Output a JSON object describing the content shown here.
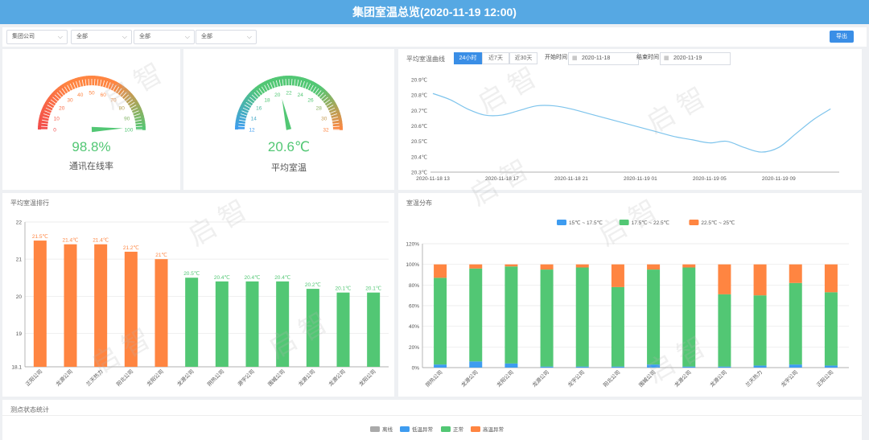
{
  "header": {
    "title": "集团室温总览(2020-11-19 12:00)"
  },
  "toolbar": {
    "filters": [
      "集团公司",
      "全部",
      "全部",
      "全部"
    ],
    "export_label": "导出"
  },
  "gauge_online": {
    "value_text": "98.8%",
    "value": 98.8,
    "label": "通讯在线率",
    "ticks": [
      "0",
      "10",
      "20",
      "30",
      "40",
      "50",
      "60",
      "70",
      "80",
      "90",
      "100"
    ],
    "min": 0,
    "max": 100
  },
  "gauge_temp": {
    "value_text": "20.6℃",
    "value": 20.6,
    "label": "平均室温",
    "ticks": [
      "12",
      "14",
      "16",
      "18",
      "20",
      "22",
      "24",
      "26",
      "28",
      "30",
      "32"
    ],
    "min": 12,
    "max": 32
  },
  "trend": {
    "title": "平均室温曲线",
    "tabs": [
      "24小时",
      "近7天",
      "近30天"
    ],
    "start_label": "开始时间",
    "start_value": "2020-11-18",
    "end_label": "结束时间",
    "end_value": "2020-11-19",
    "chart_data": {
      "type": "line",
      "y_ticks": [
        "20.3℃",
        "20.4℃",
        "20.5℃",
        "20.6℃",
        "20.7℃",
        "20.8℃",
        "20.9℃"
      ],
      "x_ticks": [
        "2020-11-18 13",
        "2020-11-18 17",
        "2020-11-18 21",
        "2020-11-19 01",
        "2020-11-19 05",
        "2020-11-19 09"
      ],
      "ylim": [
        20.3,
        20.9
      ],
      "x": [
        0,
        1,
        2,
        3,
        4,
        5,
        6,
        7,
        8,
        9,
        10,
        11,
        12,
        13,
        14,
        15,
        16,
        17,
        18,
        19,
        20,
        21,
        22,
        23
      ],
      "values": [
        20.81,
        20.77,
        20.71,
        20.67,
        20.67,
        20.7,
        20.73,
        20.73,
        20.71,
        20.68,
        20.65,
        20.62,
        20.59,
        20.56,
        20.53,
        20.51,
        20.49,
        20.5,
        20.46,
        20.43,
        20.46,
        20.55,
        20.64,
        20.71
      ],
      "color": "#7ec4ec"
    }
  },
  "ranking": {
    "title": "平均室温排行",
    "chart_data": {
      "type": "bar",
      "categories": [
        "正阳公司",
        "龙源公司",
        "兰天热力",
        "阳北公司",
        "龙阳公司",
        "龙源公司",
        "阴热公司",
        "源宇公司",
        "围城公司",
        "龙源公司",
        "龙源公司",
        "龙阳公司"
      ],
      "values": [
        21.5,
        21.4,
        21.4,
        21.2,
        21,
        20.5,
        20.4,
        20.4,
        20.4,
        20.2,
        20.1,
        20.1
      ],
      "value_labels": [
        "21.5℃",
        "21.4℃",
        "21.4℃",
        "21.2℃",
        "21℃",
        "20.5℃",
        "20.4℃",
        "20.4℃",
        "20.4℃",
        "20.2℃",
        "20.1℃",
        "20.1℃"
      ],
      "y_ticks": [
        "18.1",
        "19",
        "20",
        "21",
        "22"
      ],
      "ylim": [
        18.1,
        22
      ],
      "high_color": "#ff8541",
      "normal_color": "#52c774"
    }
  },
  "distribution": {
    "title": "室温分布",
    "chart_data": {
      "type": "bar",
      "stacked": true,
      "categories": [
        "阴热公司",
        "龙源公司",
        "龙阳公司",
        "龙源公司",
        "龙宇公司",
        "阳北公司",
        "围城公司",
        "龙源公司",
        "龙源公司",
        "兰天热力",
        "龙宇公司",
        "正阳公司"
      ],
      "y_ticks": [
        "0%",
        "20%",
        "40%",
        "60%",
        "80%",
        "100%",
        "120%"
      ],
      "ylim": [
        0,
        120
      ],
      "series": [
        {
          "name": "15℃ ~ 17.5℃",
          "color": "#3e9cf0",
          "values": [
            3,
            6,
            4,
            1,
            1,
            1,
            3,
            1,
            1,
            2,
            3,
            2
          ]
        },
        {
          "name": "17.5℃ ~ 22.5℃",
          "color": "#52c774",
          "values": [
            84,
            90,
            94,
            94,
            96,
            77,
            92,
            96,
            70,
            68,
            79,
            71
          ]
        },
        {
          "name": "22.5℃ ~ 25℃",
          "color": "#ff8541",
          "values": [
            13,
            4,
            2,
            5,
            3,
            22,
            5,
            3,
            29,
            30,
            18,
            27
          ]
        }
      ]
    }
  },
  "status": {
    "title": "测点状态统计",
    "legend": [
      {
        "name": "离线",
        "color": "#aaaaaa"
      },
      {
        "name": "低温异常",
        "color": "#3e9cf0"
      },
      {
        "name": "正常",
        "color": "#52c774"
      },
      {
        "name": "高温异常",
        "color": "#ff8541"
      }
    ]
  },
  "watermark": "启 智"
}
